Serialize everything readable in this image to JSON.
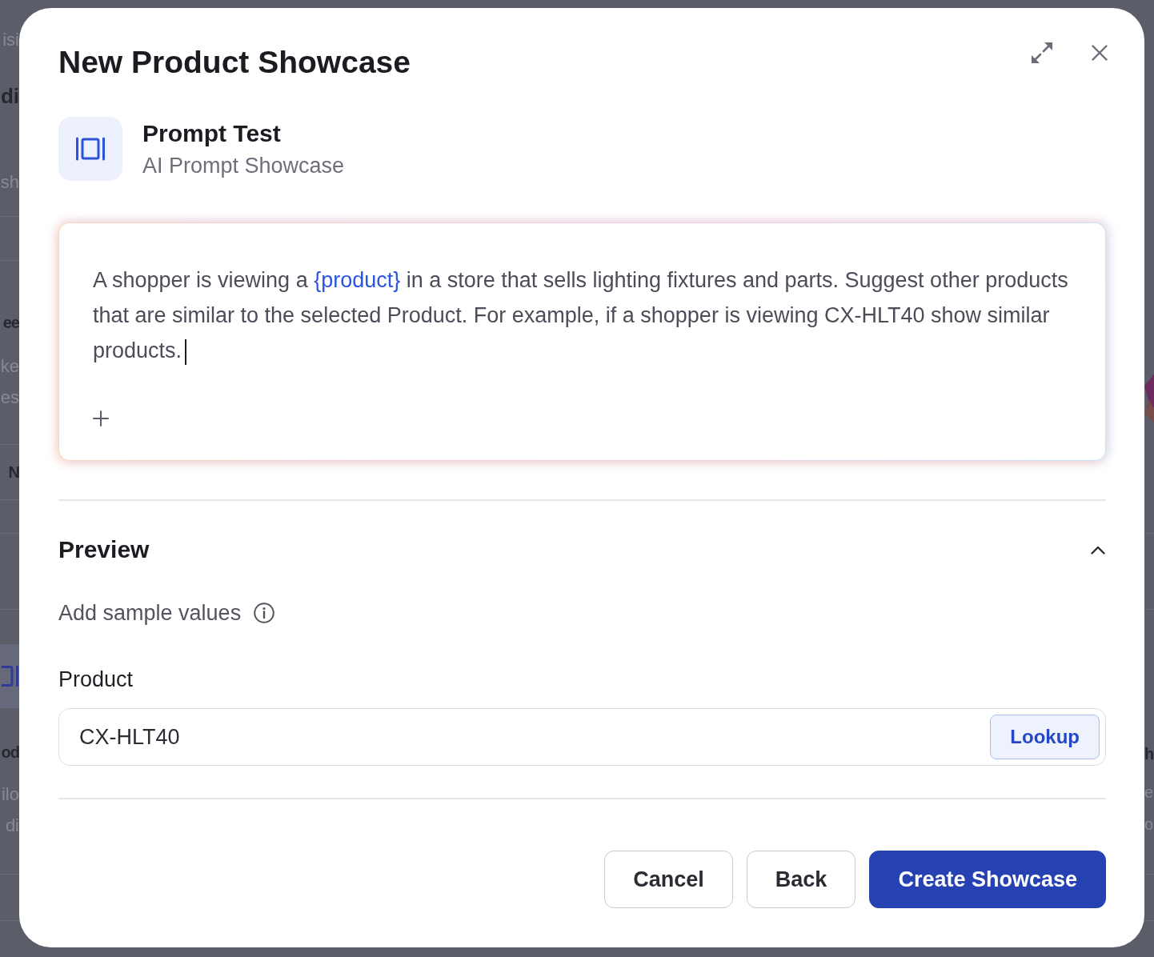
{
  "background_page": {
    "left_fragments": [
      {
        "text": "isi",
        "kind": "muted"
      },
      {
        "text": "di",
        "kind": "title"
      },
      {
        "text": "sh",
        "kind": "muted"
      },
      {
        "text": "ee",
        "kind": "heading"
      },
      {
        "text": "ke",
        "kind": "muted"
      },
      {
        "text": "es",
        "kind": "muted"
      },
      {
        "text": "N",
        "kind": "heading"
      },
      {
        "text": "od",
        "kind": "heading"
      },
      {
        "text": "ilo",
        "kind": "muted"
      },
      {
        "text": "di",
        "kind": "muted"
      }
    ],
    "right_fragments": [
      {
        "text": "h",
        "kind": "heading"
      },
      {
        "text": "e",
        "kind": "muted"
      },
      {
        "text": "o",
        "kind": "muted"
      }
    ]
  },
  "dialog": {
    "title": "New Product Showcase",
    "app": {
      "name": "Prompt Test",
      "type": "AI Prompt Showcase"
    },
    "prompt_editor": {
      "focused": true,
      "segments": [
        {
          "text": "A shopper is viewing a ",
          "kind": "plain"
        },
        {
          "text": "{product}",
          "kind": "variable"
        },
        {
          "text": " in a store that sells lighting fixtures and parts. Suggest other products that are similar to the selected Product. For example, if a shopper is viewing CX-HLT40 show similar products.",
          "kind": "plain"
        }
      ]
    },
    "preview": {
      "title": "Preview",
      "expanded": true,
      "hint": "Add sample values",
      "fields": [
        {
          "label": "Product",
          "value": "CX-HLT40",
          "action": "Lookup"
        }
      ]
    },
    "buttons": [
      {
        "label": "Cancel",
        "kind": "secondary"
      },
      {
        "label": "Back",
        "kind": "secondary"
      },
      {
        "label": "Create Showcase",
        "kind": "primary"
      }
    ]
  }
}
